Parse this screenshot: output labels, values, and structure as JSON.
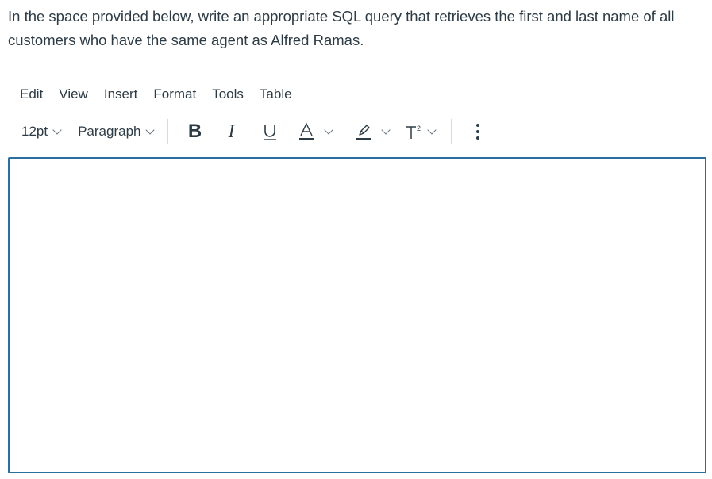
{
  "question": {
    "text": "In the space provided below, write an appropriate SQL query that retrieves the first and last name of all customers who have the same agent as Alfred Ramas."
  },
  "menubar": {
    "items": [
      {
        "label": "Edit"
      },
      {
        "label": "View"
      },
      {
        "label": "Insert"
      },
      {
        "label": "Format"
      },
      {
        "label": "Tools"
      },
      {
        "label": "Table"
      }
    ]
  },
  "toolbar": {
    "font_size": "12pt",
    "block_format": "Paragraph",
    "bold_label": "B",
    "italic_label": "I",
    "icons": {
      "bold": "bold-icon",
      "italic": "italic-icon",
      "underline": "underline-icon",
      "text_color": "text-color-icon",
      "highlight": "highlight-icon",
      "superscript": "superscript-icon",
      "more": "more-vertical-icon"
    }
  },
  "editor": {
    "value": "",
    "focus_border_color": "#2b6fa0"
  }
}
